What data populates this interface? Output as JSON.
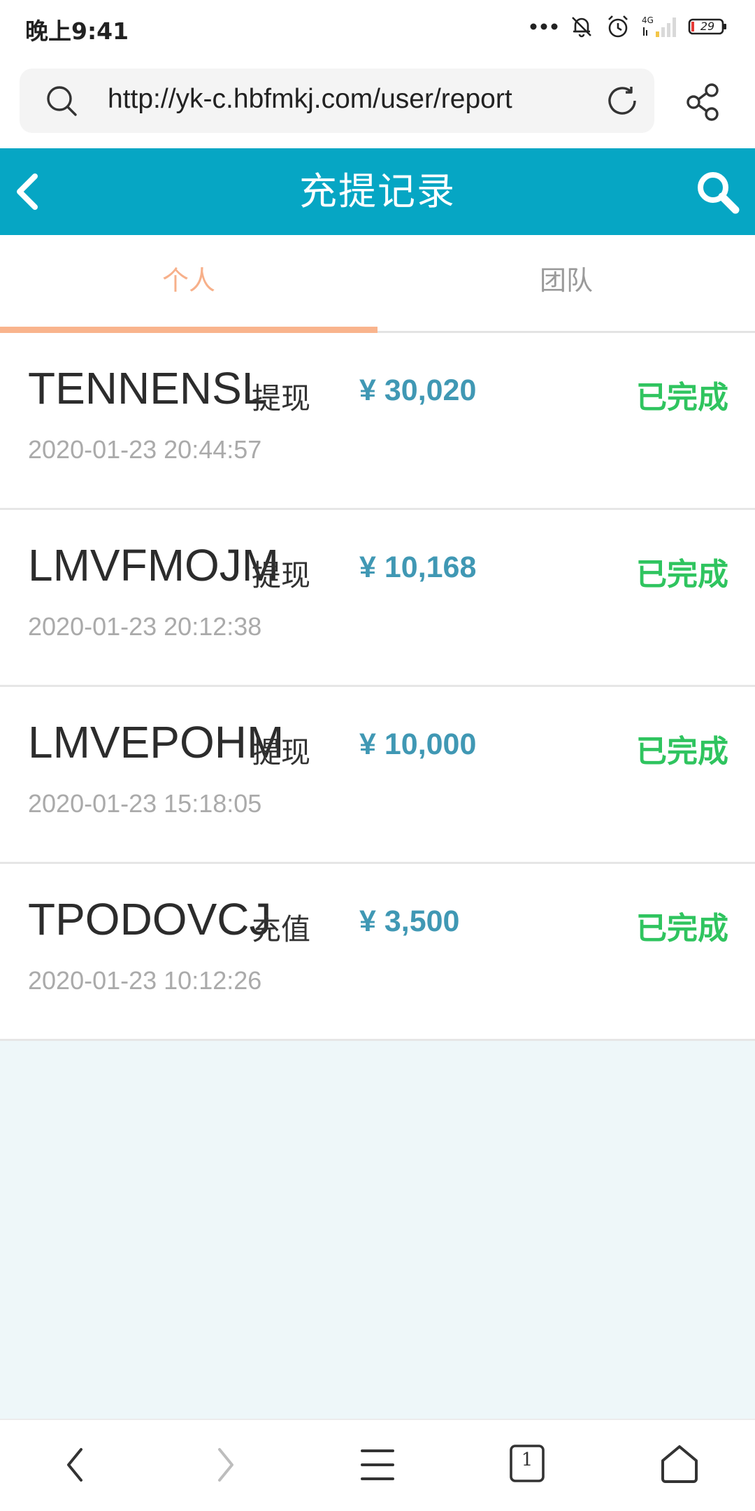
{
  "status_bar": {
    "time": "晚上9:41",
    "network": "4G",
    "battery": "29"
  },
  "browser": {
    "url": "http://yk-c.hbfmkj.com/user/report",
    "tab_count": "1"
  },
  "header": {
    "title": "充提记录"
  },
  "tabs": [
    {
      "label": "个人",
      "active": true
    },
    {
      "label": "团队",
      "active": false
    }
  ],
  "records": [
    {
      "id": "TENNENSL",
      "type": "提现",
      "amount": "¥ 30,020",
      "status": "已完成",
      "time": "2020-01-23 20:44:57"
    },
    {
      "id": "LMVFMOJM",
      "type": "提现",
      "amount": "¥ 10,168",
      "status": "已完成",
      "time": "2020-01-23 20:12:38"
    },
    {
      "id": "LMVEPOHM",
      "type": "提现",
      "amount": "¥ 10,000",
      "status": "已完成",
      "time": "2020-01-23 15:18:05"
    },
    {
      "id": "TPODOVCJ",
      "type": "充值",
      "amount": "¥ 3,500",
      "status": "已完成",
      "time": "2020-01-23 10:12:26"
    }
  ],
  "colors": {
    "header_bg": "#06a6c4",
    "tab_active": "#f7b08a",
    "amount": "#4098b4",
    "status_done": "#2fc45f"
  }
}
